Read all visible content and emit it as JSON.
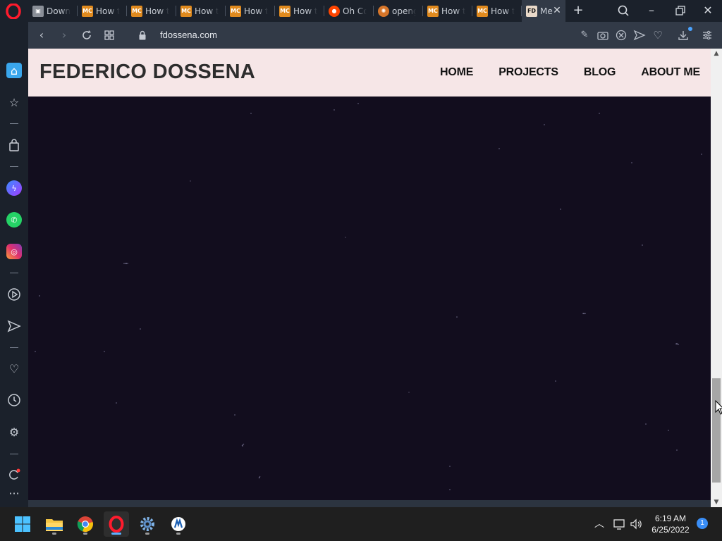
{
  "browser": {
    "name": "Opera",
    "tabs": [
      {
        "favicon": "box-icon",
        "title": "Downl",
        "active": false
      },
      {
        "favicon": "mc-icon",
        "title": "How to",
        "active": false
      },
      {
        "favicon": "mc-icon",
        "title": "How to",
        "active": false
      },
      {
        "favicon": "mc-icon",
        "title": "How to",
        "active": false
      },
      {
        "favicon": "mc-icon",
        "title": "How to",
        "active": false
      },
      {
        "favicon": "mc-icon",
        "title": "How to",
        "active": false
      },
      {
        "favicon": "reddit-icon",
        "title": "Oh Co",
        "active": false
      },
      {
        "favicon": "gear-icon",
        "title": "openg",
        "active": false
      },
      {
        "favicon": "mc-icon",
        "title": "How to",
        "active": false
      },
      {
        "favicon": "mc-icon",
        "title": "How to",
        "active": false
      },
      {
        "favicon": "fd-icon",
        "title": "Me",
        "active": true
      }
    ],
    "favicon_labels": {
      "mc": "MC",
      "fd": "FD",
      "box": "▣",
      "reddit": "●",
      "gear": "✺"
    },
    "address": {
      "url": "fdossena.com"
    }
  },
  "site": {
    "title": "FEDERICO DOSSENA",
    "nav": [
      "HOME",
      "PROJECTS",
      "BLOG",
      "ABOUT ME"
    ],
    "header_bg": "#f6e6e7",
    "body_bg": "#120d1e"
  },
  "taskbar": {
    "apps": [
      "windows-start-icon",
      "file-explorer-icon",
      "chrome-icon",
      "opera-icon",
      "settings-icon",
      "app-icon"
    ],
    "clock": {
      "time": "6:19 AM",
      "date": "6/25/2022"
    },
    "notification_count": "1"
  }
}
